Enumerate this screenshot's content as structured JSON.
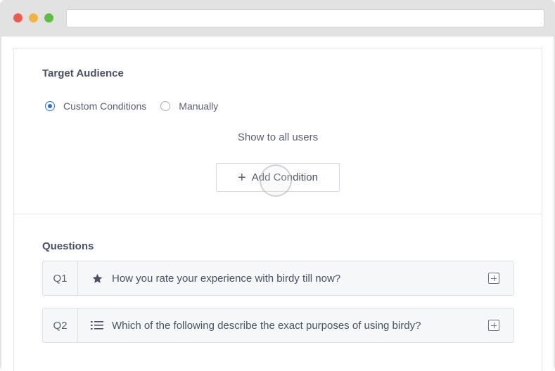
{
  "target_audience": {
    "title": "Target Audience",
    "options": [
      {
        "label": "Custom Conditions",
        "checked": true
      },
      {
        "label": "Manually",
        "checked": false
      }
    ],
    "show_all_text": "Show to all users",
    "add_condition_label": "Add Condition"
  },
  "questions": {
    "title": "Questions",
    "items": [
      {
        "number": "Q1",
        "icon": "star-icon",
        "text": "How you rate your experience with birdy till now?"
      },
      {
        "number": "Q2",
        "icon": "list-icon",
        "text": "Which of the following describe the exact purposes of using birdy?"
      }
    ]
  },
  "colors": {
    "accent": "#2f6fd6",
    "close": "#ee5a4d",
    "minimize": "#f2b33f",
    "maximize": "#5dbf3f"
  }
}
